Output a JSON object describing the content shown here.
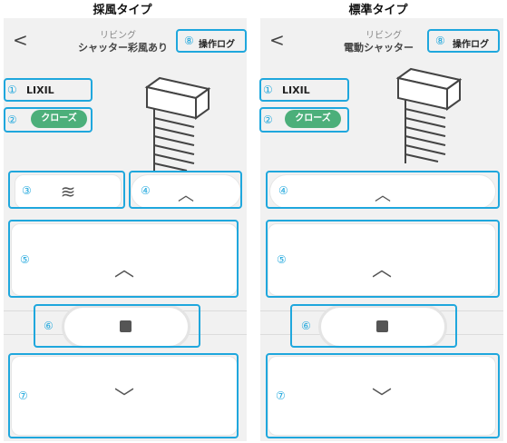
{
  "captions": {
    "left": "採風タイプ",
    "right": "標準タイプ"
  },
  "left_panel": {
    "back_glyph": "<",
    "subtitle": "リビング",
    "title": "シャッター彩風あり",
    "log_button": "操作ログ",
    "brand": "LIXIL",
    "status": "クローズ",
    "vent_glyph": "≋",
    "vent_up_glyph": "︿",
    "up_glyph": "︿",
    "down_glyph": "﹀",
    "markers": [
      "①",
      "②",
      "③",
      "④",
      "⑤",
      "⑥",
      "⑦",
      "⑧"
    ]
  },
  "right_panel": {
    "back_glyph": "<",
    "subtitle": "リビング",
    "title": "電動シャッター",
    "log_button": "操作ログ",
    "brand": "LIXIL",
    "status": "クローズ",
    "vent_up_glyph": "︿",
    "up_glyph": "︿",
    "down_glyph": "﹀",
    "markers": [
      "①",
      "②",
      "④",
      "⑤",
      "⑥",
      "⑦",
      "⑧"
    ]
  },
  "colors": {
    "highlight": "#1fa7dd",
    "status_pill": "#4caf7a",
    "panel_bg": "#f1f1f1"
  }
}
